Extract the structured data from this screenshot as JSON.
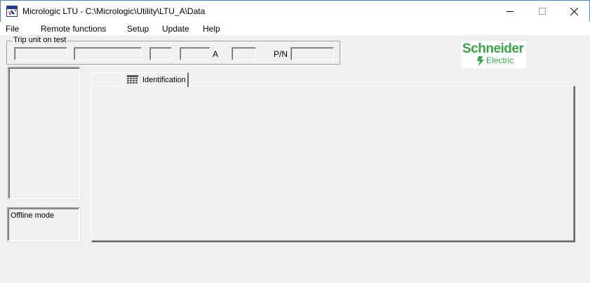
{
  "window": {
    "title": "Micrologic LTU - C:\\Micrologic\\Utility\\LTU_A\\Data"
  },
  "menu": {
    "items": [
      "File",
      "Remote functions",
      "Setup",
      "Update",
      "Help"
    ]
  },
  "trip_unit": {
    "legend": "Trip unit on test",
    "fields": [
      "",
      "",
      "",
      "",
      ""
    ],
    "amp_unit": "A",
    "pn_label": "P/N",
    "pn_value": ""
  },
  "logo": {
    "name_top": "Schneider",
    "name_bottom": "Electric",
    "color": "#3da34a"
  },
  "status": {
    "mode_text": "Offline mode"
  },
  "tabs": [
    {
      "label": "Identification",
      "icon": "grid-table-icon"
    }
  ],
  "colors": {
    "background": "#f0f0f0",
    "titlebar_border": "#4a8ac9"
  }
}
